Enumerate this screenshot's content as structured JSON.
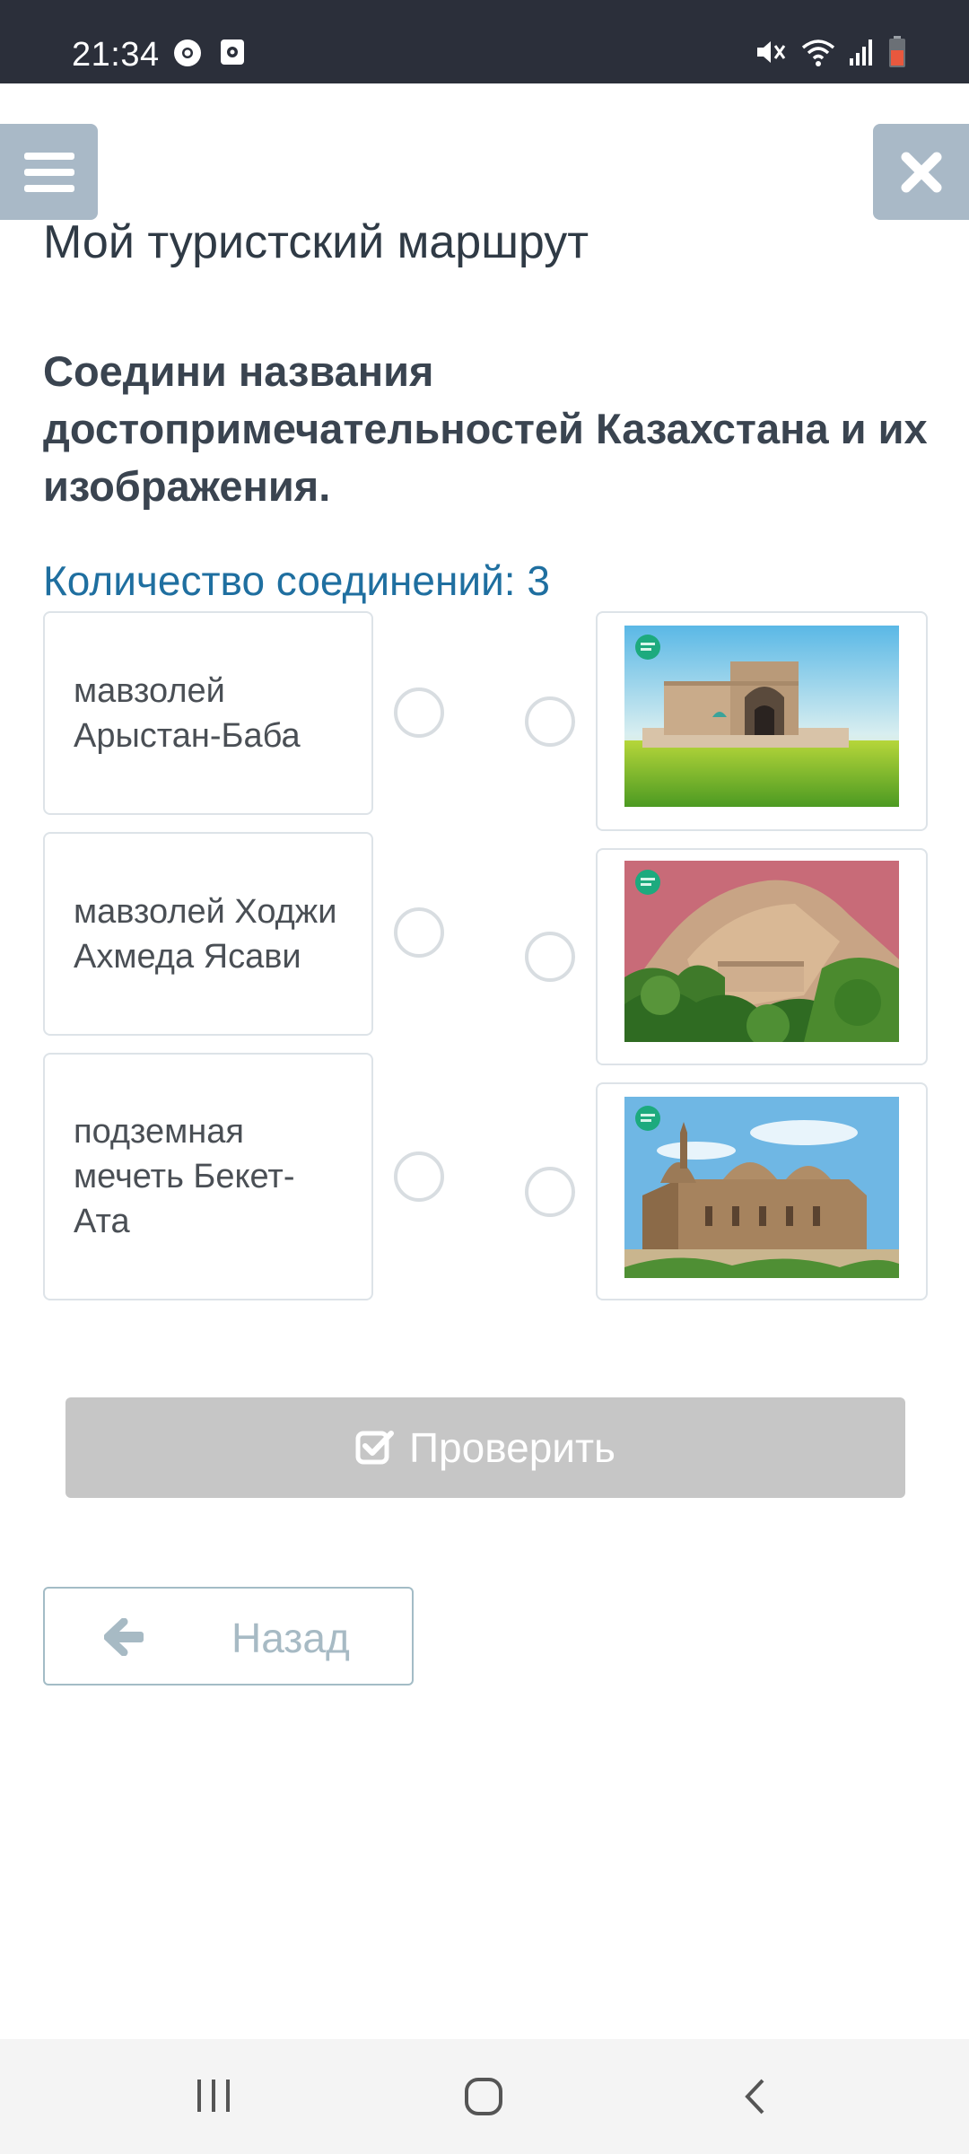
{
  "status_bar": {
    "time": "21:34",
    "icons": [
      "chrome-icon",
      "screen-record-icon",
      "mute-icon",
      "wifi-icon",
      "signal-icon",
      "battery-icon"
    ]
  },
  "header": {
    "menu_icon": "hamburger-icon",
    "close_icon": "close-icon"
  },
  "page": {
    "title": "Мой туристский маршрут",
    "question": "Соедини названия достопримечательностей Казахстана и их изображения.",
    "connection_count": "Количество соединений: 3"
  },
  "left_items": [
    {
      "label": "мавзолей Арыстан-Баба"
    },
    {
      "label": "мавзолей Ходжи Ахмеда Ясави"
    },
    {
      "label": "подземная мечеть Бекет-Ата"
    }
  ],
  "right_items": [
    {
      "image": "mausoleum-illustration"
    },
    {
      "image": "rocky-hill-illustration"
    },
    {
      "image": "domed-building-illustration"
    }
  ],
  "actions": {
    "check_label": "Проверить",
    "back_label": "Назад"
  },
  "colors": {
    "accent": "#1f6fa0",
    "header_button": "#a9b9c7",
    "check_button": "#c6c6c6",
    "status_bar": "#2b2f3a"
  },
  "nav_bar": {
    "icons": [
      "recents-icon",
      "home-icon",
      "back-icon"
    ]
  }
}
